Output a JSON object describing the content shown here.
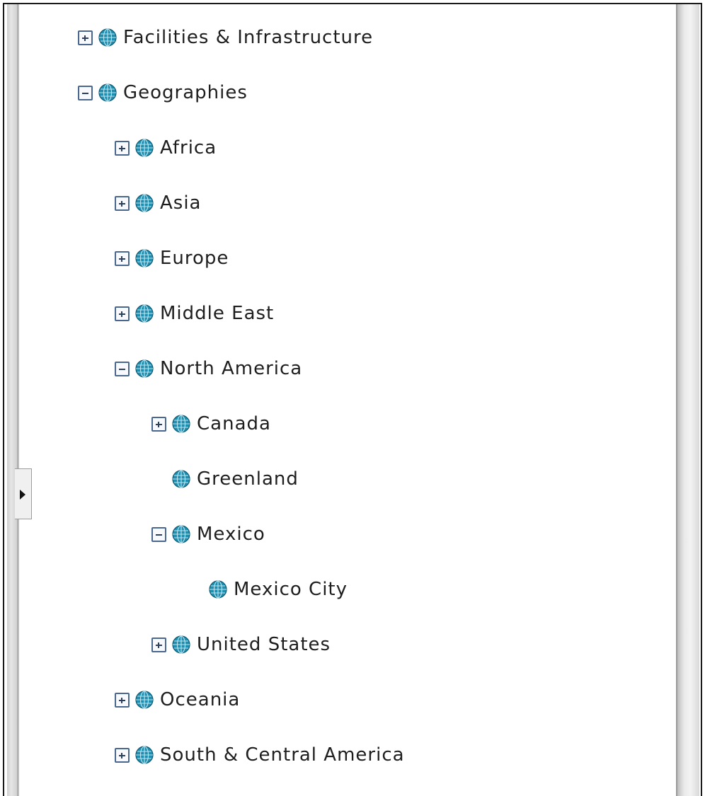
{
  "tree": {
    "items": [
      {
        "label": "Facilities & Infrastructure",
        "level": 0,
        "state": "collapsed"
      },
      {
        "label": "Geographies",
        "level": 0,
        "state": "expanded"
      },
      {
        "label": "Africa",
        "level": 1,
        "state": "collapsed"
      },
      {
        "label": "Asia",
        "level": 1,
        "state": "collapsed"
      },
      {
        "label": "Europe",
        "level": 1,
        "state": "collapsed"
      },
      {
        "label": "Middle East",
        "level": 1,
        "state": "collapsed"
      },
      {
        "label": "North America",
        "level": 1,
        "state": "expanded"
      },
      {
        "label": "Canada",
        "level": 2,
        "state": "collapsed"
      },
      {
        "label": "Greenland",
        "level": 2,
        "state": "leaf"
      },
      {
        "label": "Mexico",
        "level": 2,
        "state": "expanded"
      },
      {
        "label": "Mexico City",
        "level": 3,
        "state": "leaf"
      },
      {
        "label": "United States",
        "level": 2,
        "state": "collapsed"
      },
      {
        "label": "Oceania",
        "level": 1,
        "state": "collapsed"
      },
      {
        "label": "South & Central America",
        "level": 1,
        "state": "collapsed"
      }
    ],
    "icon": "globe-icon",
    "colors": {
      "globe": "#1f8fb0",
      "toggle_border": "#4a6790",
      "text": "#1e1e1e"
    }
  },
  "panel": {
    "collapse_handle_icon": "arrow-right-icon"
  }
}
